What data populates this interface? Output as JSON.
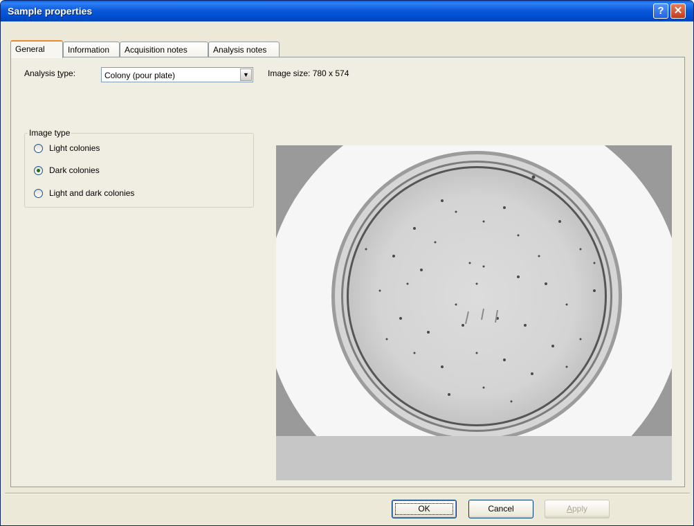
{
  "window": {
    "title": "Sample properties",
    "help_glyph": "?",
    "close_glyph": "✕"
  },
  "tabs": [
    {
      "label": "General"
    },
    {
      "label": "Information"
    },
    {
      "label": "Acquisition notes"
    },
    {
      "label": "Analysis notes"
    }
  ],
  "general": {
    "analysis_type_label_pre": "Analysis ",
    "analysis_type_label_key": "t",
    "analysis_type_label_post": "ype:",
    "analysis_type_value": "Colony (pour plate)",
    "image_size_text": "Image size: 780 x 574",
    "image_type_group": {
      "legend": "Image type",
      "options": [
        {
          "label": "Light colonies",
          "checked": false
        },
        {
          "label": "Dark colonies",
          "checked": true
        },
        {
          "label": "Light and dark colonies",
          "checked": false
        }
      ]
    },
    "image_description": "petri-dish-image"
  },
  "buttons": {
    "ok": "OK",
    "cancel": "Cancel",
    "apply_key": "A",
    "apply_rest": "pply"
  },
  "icons": {
    "combo_arrow": "chevron-down-icon"
  }
}
